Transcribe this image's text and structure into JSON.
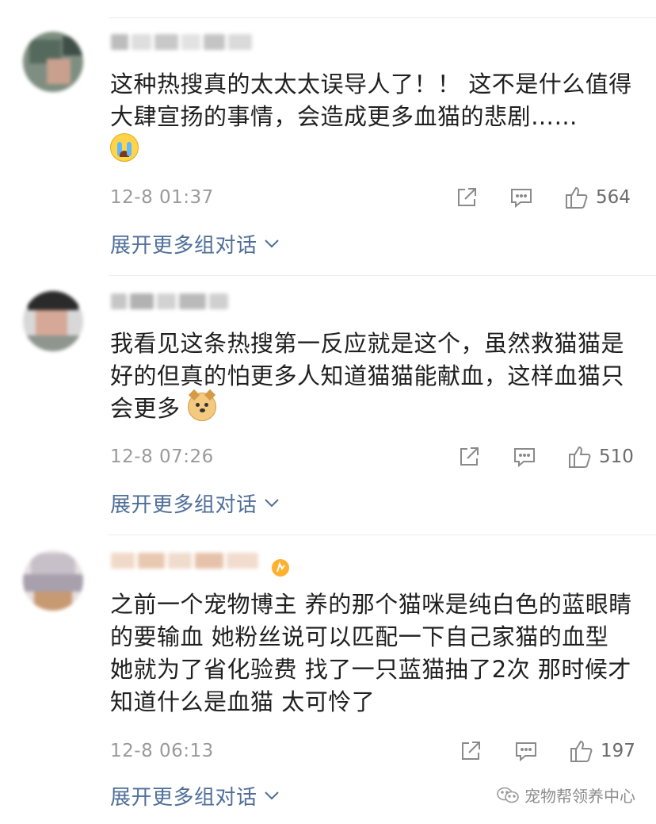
{
  "comments": [
    {
      "text": "这种热搜真的太太太误导人了！！ 这不是什么值得大肆宣扬的事情，会造成更多血猫的悲剧……",
      "emoji": "loudly-crying-face",
      "timestamp": "12-8 01:37",
      "likes": "564",
      "expand_label": "展开更多组对话"
    },
    {
      "text": "我看见这条热搜第一反应就是这个，虽然救猫猫是好的但真的怕更多人知道猫猫能献血，这样血猫只会更多",
      "emoji": "doge-face",
      "timestamp": "12-8 07:26",
      "likes": "510",
      "expand_label": "展开更多组对话"
    },
    {
      "text": "之前一个宠物博主 养的那个猫咪是纯白色的蓝眼睛的要输血 她粉丝说可以匹配一下自己家猫的血型 她就为了省化验费 找了一只蓝猫抽了2次 那时候才知道什么是血猫 太可怜了",
      "timestamp": "12-8 06:13",
      "likes": "197",
      "expand_label": "展开更多组对话"
    }
  ],
  "watermark": {
    "text": "宠物帮领养中心",
    "icon": "wechat-icon"
  },
  "colors": {
    "link": "#4e6e98",
    "meta": "#9a9a9a",
    "text": "#1f1f1f"
  }
}
